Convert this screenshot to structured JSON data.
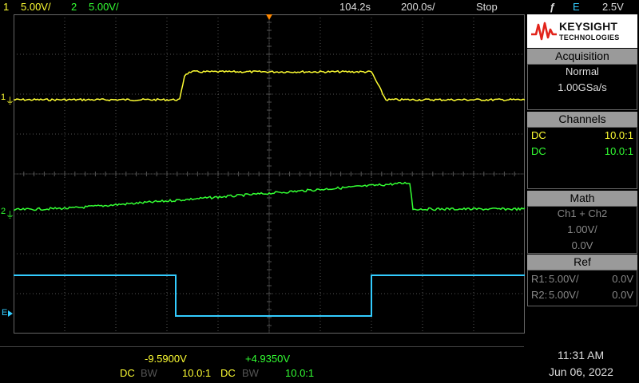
{
  "top": {
    "ch1": {
      "num": "1",
      "scale": "5.00V/"
    },
    "ch2": {
      "num": "2",
      "scale": "5.00V/"
    },
    "time_pos": "104.2s",
    "time_scale": "200.0s/",
    "run_state": "Stop",
    "trig_source": "E",
    "trig_level": "2.5V"
  },
  "markers": {
    "ch1": "1",
    "ch2": "2",
    "ext": "E"
  },
  "logo": {
    "title": "KEYSIGHT",
    "subtitle": "TECHNOLOGIES"
  },
  "acquisition": {
    "title": "Acquisition",
    "mode": "Normal",
    "rate": "1.00GSa/s"
  },
  "channels": {
    "title": "Channels",
    "rows": [
      {
        "coupling": "DC",
        "probe": "10.0:1"
      },
      {
        "coupling": "DC",
        "probe": "10.0:1"
      }
    ]
  },
  "math": {
    "title": "Math",
    "func": "Ch1 + Ch2",
    "scale": "1.00V/",
    "offset": "0.0V"
  },
  "ref": {
    "title": "Ref",
    "rows": [
      {
        "name": "R1:",
        "scale": "5.00V/",
        "offset": "0.0V"
      },
      {
        "name": "R2:",
        "scale": "5.00V/",
        "offset": "0.0V"
      }
    ]
  },
  "bottom": {
    "ch1_offset": "-9.5900V",
    "ch2_offset": "+4.9350V",
    "ch1": {
      "coupling": "DC",
      "bw": "BW",
      "probe": "10.0:1"
    },
    "ch2": {
      "coupling": "DC",
      "bw": "BW",
      "probe": "10.0:1"
    },
    "time": "11:31 AM",
    "date": "Jun 06, 2022"
  },
  "colors": {
    "ch1": "#ffff33",
    "ch2": "#33ff33",
    "ext": "#33ccff",
    "grid": "#555555"
  }
}
